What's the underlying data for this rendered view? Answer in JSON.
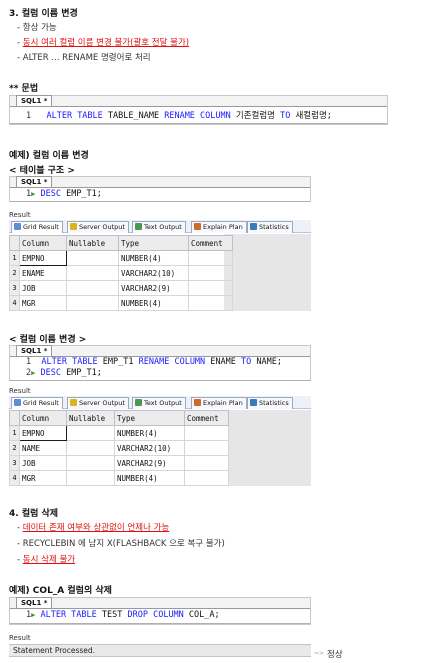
{
  "section3": {
    "title": "3. 컬럼 이름 변경",
    "bullets": [
      {
        "text": "- 항상 가능",
        "red": false
      },
      {
        "prefix": "- ",
        "text": "동시 여러 컬럼 이름 변경 불가(괄호 전달 불가)",
        "red": true
      },
      {
        "text": "- ALTER ... RENAME 명령어로 처리",
        "red": false
      }
    ]
  },
  "syntax": {
    "title": "** 문법",
    "tab": "SQL1 *",
    "line_no": "1",
    "code": {
      "kw1": "ALTER TABLE",
      "t1": "TABLE_NAME",
      "kw2": "RENAME COLUMN",
      "t2": "기존컬럼명",
      "kw3": "TO",
      "t3": "새컬럼명;"
    }
  },
  "example1": {
    "title": "예제) 컬럼 이름 변경",
    "sub1": "< 테이블 구조 >",
    "sub2": "< 컬럼 이름 변경 >"
  },
  "editor1": {
    "tab": "SQL1 *",
    "line_no": "1",
    "kw": "DESC",
    "rest": "EMP_T1;"
  },
  "editor2": {
    "tab": "SQL1 *",
    "line1_no": "1",
    "line1": {
      "kw1": "ALTER TABLE",
      "t1": "EMP_T1",
      "kw2": "RENAME COLUMN",
      "t2": "ENAME",
      "kw3": "TO",
      "t3": "NAME;"
    },
    "line2_no": "2",
    "line2": {
      "kw": "DESC",
      "rest": "EMP_T1;"
    }
  },
  "result_tabs": {
    "label": "Result",
    "tabs": [
      "Grid Result",
      "Server Output",
      "Text Output",
      "Explain Plan",
      "Statistics"
    ]
  },
  "grid1": {
    "columns": [
      "Column",
      "Nullable",
      "Type",
      "Comment"
    ],
    "rows": [
      {
        "n": "1",
        "column": "EMPNO",
        "nullable": "",
        "type": "NUMBER(4)",
        "comment": ""
      },
      {
        "n": "2",
        "column": "ENAME",
        "nullable": "",
        "type": "VARCHAR2(10)",
        "comment": ""
      },
      {
        "n": "3",
        "column": "JOB",
        "nullable": "",
        "type": "VARCHAR2(9)",
        "comment": ""
      },
      {
        "n": "4",
        "column": "MGR",
        "nullable": "",
        "type": "NUMBER(4)",
        "comment": ""
      }
    ]
  },
  "grid2": {
    "columns": [
      "Column",
      "Nullable",
      "Type",
      "Comment"
    ],
    "rows": [
      {
        "n": "1",
        "column": "EMPNO",
        "nullable": "",
        "type": "NUMBER(4)",
        "comment": ""
      },
      {
        "n": "2",
        "column": "NAME",
        "nullable": "",
        "type": "VARCHAR2(10)",
        "comment": ""
      },
      {
        "n": "3",
        "column": "JOB",
        "nullable": "",
        "type": "VARCHAR2(9)",
        "comment": ""
      },
      {
        "n": "4",
        "column": "MGR",
        "nullable": "",
        "type": "NUMBER(4)",
        "comment": ""
      }
    ]
  },
  "section4": {
    "title": "4. 컬럼 삭제",
    "bullets": [
      {
        "prefix": "- ",
        "text": "데이터 존재 여부와 상관없이 언제나 가능",
        "red": true
      },
      {
        "text": "- RECYCLEBIN 에 남지 X(FLASHBACK 으로 복구 불가)",
        "red": false
      },
      {
        "prefix": "- ",
        "text": "동시 삭제 불가",
        "red": true
      }
    ]
  },
  "example2": {
    "title": "예제) COL_A 컬럼의 삭제",
    "tab": "SQL1 *",
    "line_no": "1",
    "code": {
      "kw1": "ALTER TABLE",
      "t1": "TEST",
      "kw2": "DROP COLUMN",
      "t2": "COL_A;"
    },
    "result_label": "Result",
    "status": "Statement Processed.",
    "note_arrow": "=>",
    "note": "정상"
  },
  "colors": {
    "keyword": "#1a1aff",
    "emphasis": "#e01010",
    "arrow": "#2a9d2a"
  }
}
